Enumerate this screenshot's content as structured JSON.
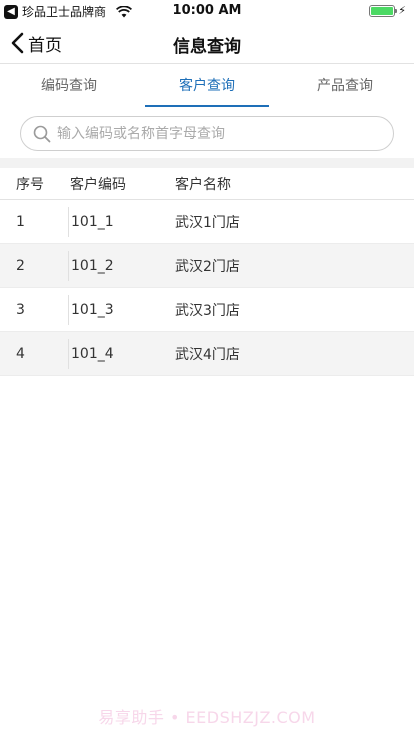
{
  "status_bar": {
    "carrier": "珍品卫士品牌商",
    "time": "10:00 AM",
    "battery_level": 1.0
  },
  "nav": {
    "back_label": "首页",
    "title": "信息查询"
  },
  "tabs": [
    {
      "label": "编码查询",
      "active": false
    },
    {
      "label": "客户查询",
      "active": true
    },
    {
      "label": "产品查询",
      "active": false
    }
  ],
  "search": {
    "placeholder": "输入编码或名称首字母查询",
    "value": ""
  },
  "table": {
    "columns": [
      "序号",
      "客户编码",
      "客户名称"
    ],
    "rows": [
      {
        "index": "1",
        "code": "101_1",
        "name": "武汉1门店"
      },
      {
        "index": "2",
        "code": "101_2",
        "name": "武汉2门店"
      },
      {
        "index": "3",
        "code": "101_3",
        "name": "武汉3门店"
      },
      {
        "index": "4",
        "code": "101_4",
        "name": "武汉4门店"
      }
    ]
  },
  "watermark": "易享助手 • EEDSHZJZ.COM",
  "colors": {
    "accent": "#1e6fb8",
    "battery": "#4cd964",
    "row_alt": "#f4f4f4"
  }
}
